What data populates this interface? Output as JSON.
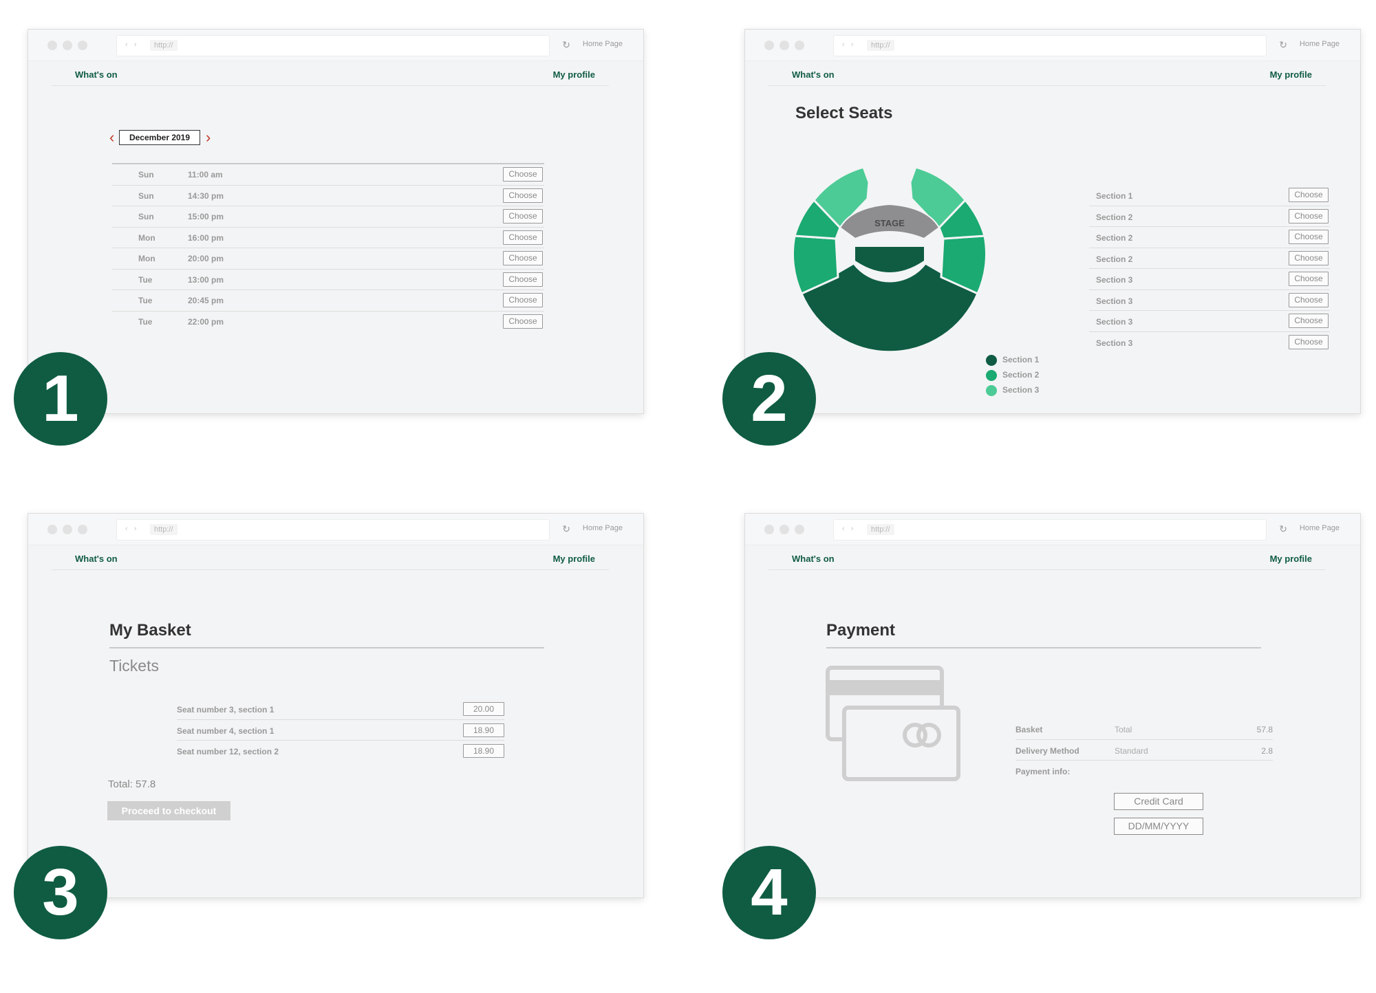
{
  "browser": {
    "address_text": "http://",
    "home_link": "Home Page",
    "reload_icon": "↻",
    "nav_arrows": "‹ ›"
  },
  "nav": {
    "whats_on": "What's on",
    "my_profile": "My profile"
  },
  "steps": [
    "1",
    "2",
    "3",
    "4"
  ],
  "showtimes": {
    "month": "December 2019",
    "prev_icon": "‹",
    "next_icon": "›",
    "rows": [
      {
        "day": "Sun",
        "time": "11:00 am",
        "action": "Choose"
      },
      {
        "day": "Sun",
        "time": "14:30 pm",
        "action": "Choose"
      },
      {
        "day": "Sun",
        "time": "15:00 pm",
        "action": "Choose"
      },
      {
        "day": "Mon",
        "time": "16:00 pm",
        "action": "Choose"
      },
      {
        "day": "Mon",
        "time": "20:00 pm",
        "action": "Choose"
      },
      {
        "day": "Tue",
        "time": "13:00 pm",
        "action": "Choose"
      },
      {
        "day": "Tue",
        "time": "20:45 pm",
        "action": "Choose"
      },
      {
        "day": "Tue",
        "time": "22:00 pm",
        "action": "Choose"
      }
    ]
  },
  "seats": {
    "title": "Select Seats",
    "stage_label": "STAGE",
    "sections": [
      {
        "label": "Section 1",
        "action": "Choose"
      },
      {
        "label": "Section 2",
        "action": "Choose"
      },
      {
        "label": "Section 2",
        "action": "Choose"
      },
      {
        "label": "Section 2",
        "action": "Choose"
      },
      {
        "label": "Section 3",
        "action": "Choose"
      },
      {
        "label": "Section 3",
        "action": "Choose"
      },
      {
        "label": "Section 3",
        "action": "Choose"
      },
      {
        "label": "Section 3",
        "action": "Choose"
      }
    ],
    "legend": [
      {
        "label": "Section 1",
        "color": "#0f5c43"
      },
      {
        "label": "Section 2",
        "color": "#1aaa72"
      },
      {
        "label": "Section 3",
        "color": "#4ccb96"
      }
    ]
  },
  "basket": {
    "title": "My Basket",
    "subtitle": "Tickets",
    "items": [
      {
        "label": "Seat number 3, section 1",
        "price": "20.00"
      },
      {
        "label": "Seat number 4, section 1",
        "price": "18.90"
      },
      {
        "label": "Seat number 12, section 2",
        "price": "18.90"
      }
    ],
    "total": "Total: 57.8",
    "checkout": "Proceed to checkout"
  },
  "payment": {
    "title": "Payment",
    "card_icon": "credit-card-icon",
    "rows": [
      {
        "label": "Basket",
        "value": "Total",
        "amount": "57.8"
      },
      {
        "label": "Delivery Method",
        "value": "Standard",
        "amount": "2.8"
      }
    ],
    "info_label": "Payment info:",
    "card_field": "Credit Card",
    "date_field": "DD/MM/YYYY"
  },
  "colors": {
    "brand_dark": "#0f5c43",
    "section1": "#0f5c43",
    "section2": "#1aaa72",
    "section3": "#4ccb96",
    "stage": "#8e8e91"
  }
}
